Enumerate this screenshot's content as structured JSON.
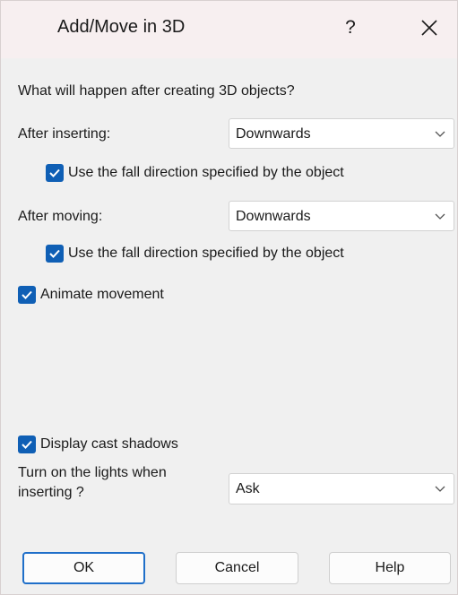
{
  "window": {
    "title": "Add/Move in 3D",
    "help_label": "?"
  },
  "form": {
    "question": "What will happen after creating 3D objects?",
    "after_inserting": {
      "label": "After inserting:",
      "selected": "Downwards",
      "use_fall_direction": {
        "checked": true,
        "label": "Use the fall direction specified by the object"
      }
    },
    "after_moving": {
      "label": "After moving:",
      "selected": "Downwards",
      "use_fall_direction": {
        "checked": true,
        "label": "Use the fall direction specified by the object"
      }
    },
    "animate_movement": {
      "checked": true,
      "label": "Animate movement"
    },
    "display_cast_shadows": {
      "checked": true,
      "label": "Display cast shadows"
    },
    "lights": {
      "label_line1": "Turn on the lights when",
      "label_line2": "inserting ?",
      "selected": "Ask"
    }
  },
  "buttons": {
    "ok": "OK",
    "cancel": "Cancel",
    "help": "Help"
  },
  "colors": {
    "checkbox_fill": "#0f5fb5",
    "primary_button_border": "#1f6fc9",
    "titlebar_bg": "#f7eff0"
  }
}
